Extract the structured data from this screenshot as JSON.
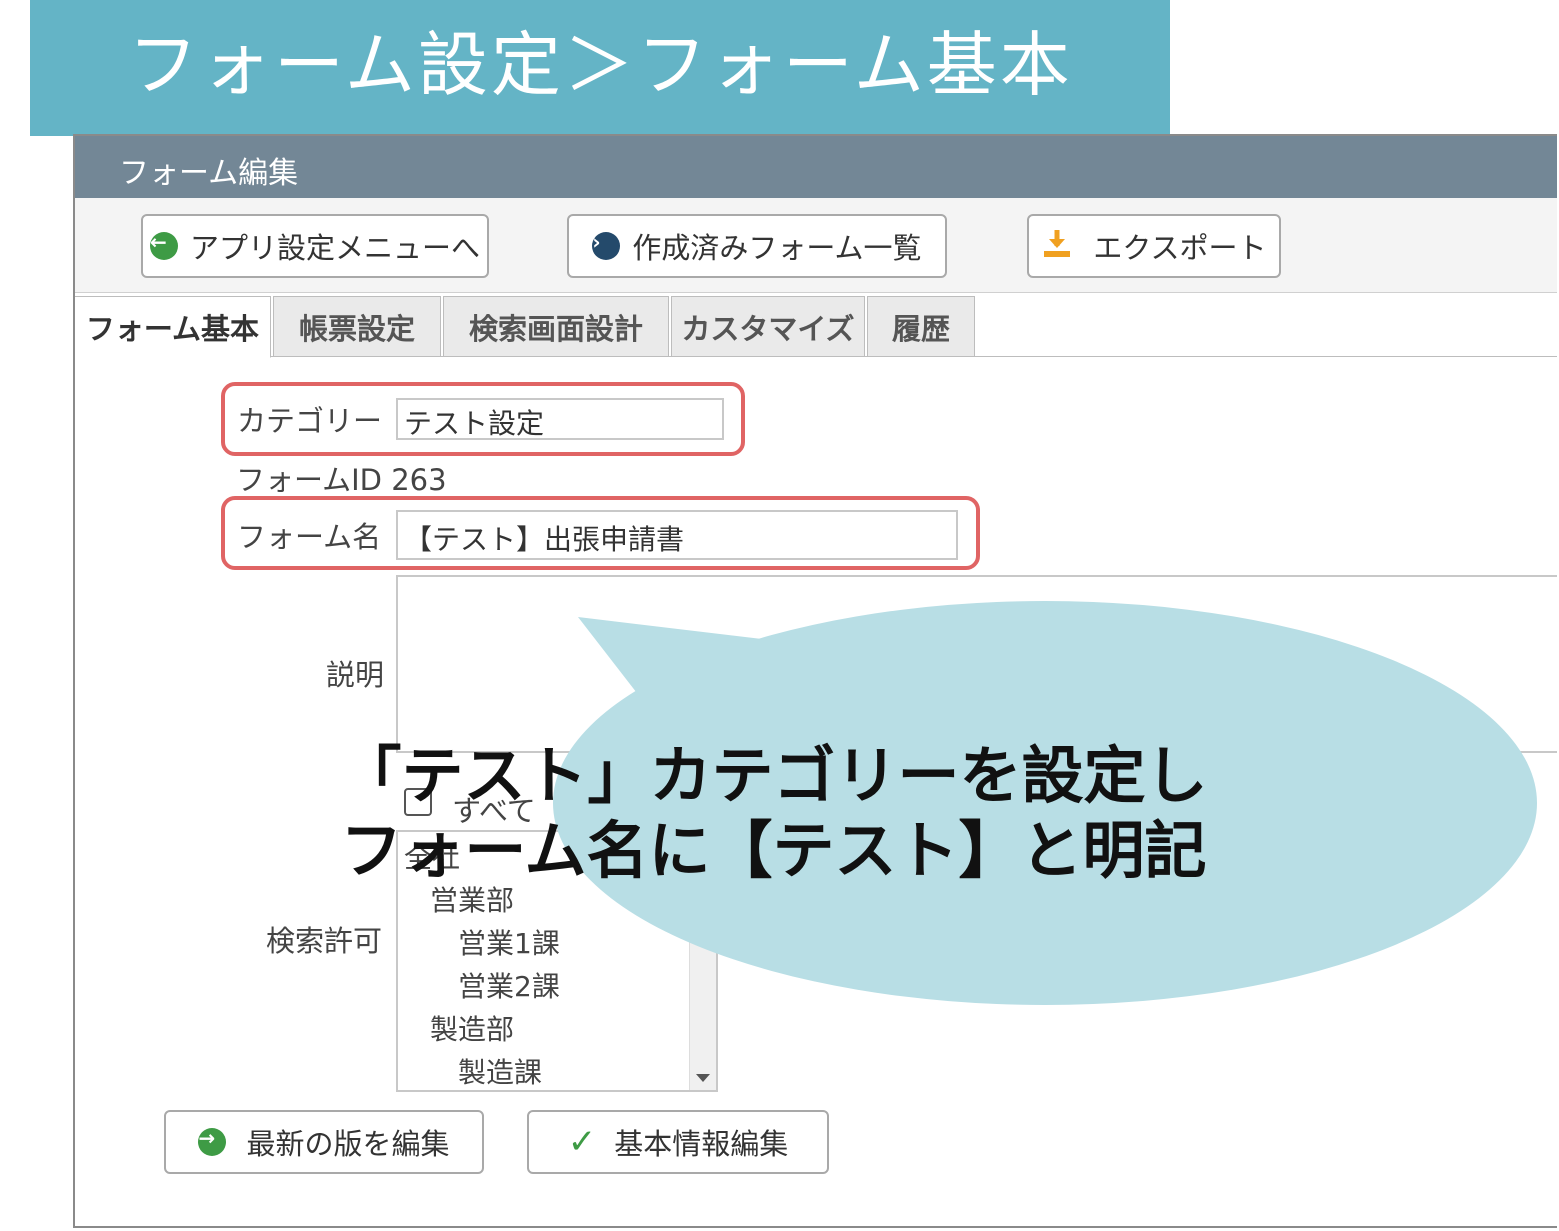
{
  "banner": {
    "title": "フォーム設定＞フォーム基本"
  },
  "window": {
    "title": "フォーム編集"
  },
  "toolbar": {
    "app_settings_menu": "アプリ設定メニューへ",
    "created_forms_list": "作成済みフォーム一覧",
    "export": "エクスポート"
  },
  "tabs": [
    {
      "label": "フォーム基本",
      "active": true
    },
    {
      "label": "帳票設定",
      "active": false
    },
    {
      "label": "検索画面設計",
      "active": false
    },
    {
      "label": "カスタマイズ",
      "active": false
    },
    {
      "label": "履歴",
      "active": false
    }
  ],
  "form": {
    "category_label": "カテゴリー",
    "category_value": "テスト設定",
    "form_id_label": "フォームID",
    "form_id_value": "263",
    "form_name_label": "フォーム名",
    "form_name_value": "【テスト】出張申請書",
    "description_label": "説明",
    "description_value": "",
    "all_checkbox_label": "すべて",
    "all_checkbox_checked": false,
    "search_permission_label": "検索許可",
    "departments": [
      "全社",
      "営業部",
      "営業1課",
      "営業2課",
      "製造部",
      "製造課"
    ]
  },
  "actions": {
    "edit_latest": "最新の版を編集",
    "edit_basic_info": "基本情報編集"
  },
  "callout": {
    "line1": "「テスト」カテゴリーを設定し",
    "line2": "フォーム名に【テスト】と明記"
  },
  "colors": {
    "banner": "#64b4c6",
    "window_header": "#738796",
    "highlight": "#e06464",
    "callout": "#b8dee5",
    "go_green": "#3e9b45",
    "go_navy": "#244a6b",
    "export_orange": "#f0a020"
  },
  "icons": {
    "app_settings_menu": "arrow-left-circle-icon",
    "created_forms_list": "arrow-right-circle-icon",
    "export": "download-icon",
    "edit_latest": "arrow-right-circle-icon",
    "edit_basic_info": "check-icon"
  }
}
